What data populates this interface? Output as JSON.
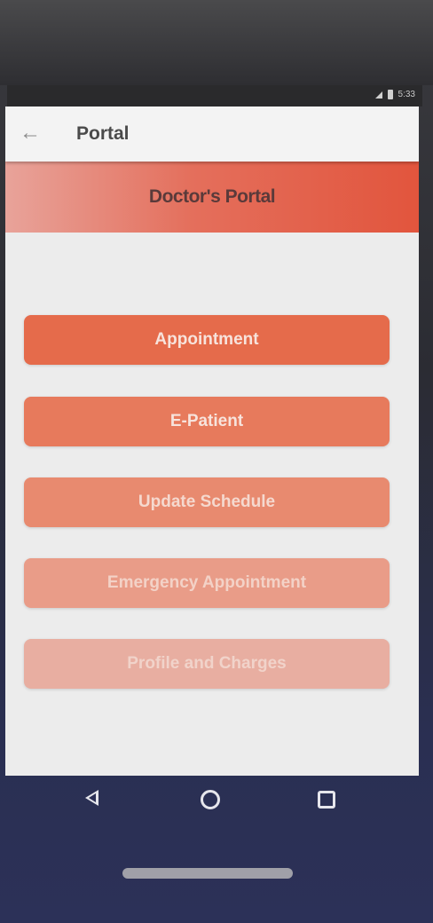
{
  "status_bar": {
    "time": "5:33"
  },
  "app_bar": {
    "back_icon": "arrow-left-icon",
    "title": "Portal"
  },
  "banner": {
    "title": "Doctor's Portal"
  },
  "menu": {
    "items": [
      {
        "label": "Appointment"
      },
      {
        "label": "E-Patient"
      },
      {
        "label": "Update Schedule"
      },
      {
        "label": "Emergency Appointment"
      },
      {
        "label": "Profile and Charges"
      }
    ]
  },
  "colors": {
    "banner_accent": "#e2553d",
    "button_primary": "#e56b4b",
    "navigation_bar": "#2b2f55"
  },
  "system_nav": {
    "back_icon": "triangle-back-icon",
    "home_icon": "circle-home-icon",
    "recents_icon": "square-recents-icon"
  }
}
